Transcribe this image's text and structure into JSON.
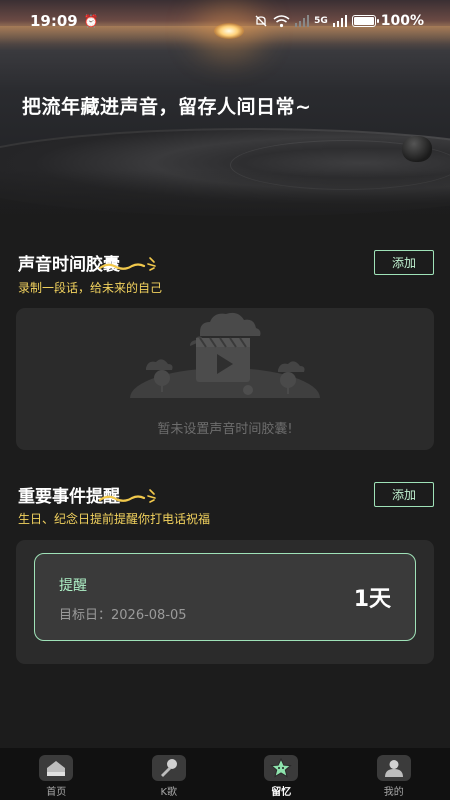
{
  "status_bar": {
    "time": "19:09",
    "network": "5G",
    "battery": "100%"
  },
  "hero": {
    "slogan": "把流年藏进声音，留存人间日常~"
  },
  "capsule": {
    "title": "声音时间胶囊",
    "subtitle": "录制一段话，给未来的自己",
    "add_label": "添加",
    "empty_text": "暂未设置声音时间胶囊!"
  },
  "events": {
    "title": "重要事件提醒",
    "subtitle": "生日、纪念日提前提醒你打电话祝福",
    "add_label": "添加",
    "reminder": {
      "title": "提醒",
      "date": "目标日：2026-08-05",
      "days": "1天"
    }
  },
  "nav": {
    "items": [
      {
        "label": "首页",
        "icon": "home-icon"
      },
      {
        "label": "K歌",
        "icon": "microphone-icon"
      },
      {
        "label": "留忆",
        "icon": "star-icon"
      },
      {
        "label": "我的",
        "icon": "profile-icon"
      }
    ],
    "active": "留忆"
  },
  "colors": {
    "accent_green": "#9fe2b8",
    "subtitle_yellow": "#f2d25e",
    "background": "#1c1c1c"
  }
}
